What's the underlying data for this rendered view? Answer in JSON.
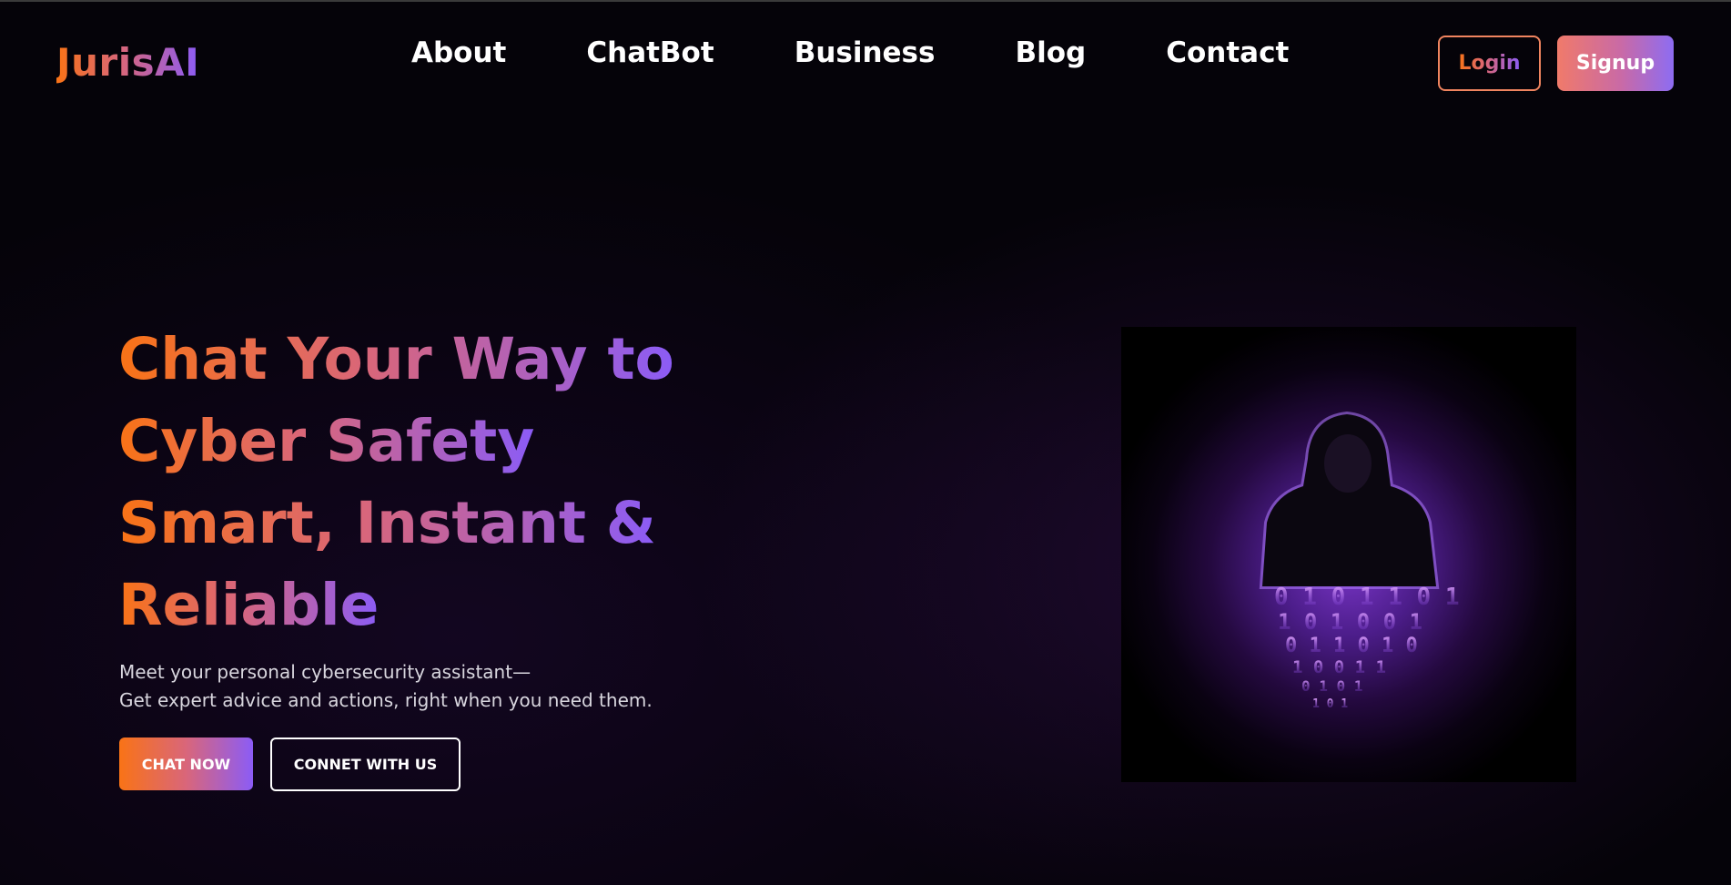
{
  "header": {
    "logo": "JurisAI",
    "nav": [
      "About",
      "ChatBot",
      "Business",
      "Blog",
      "Contact"
    ],
    "login_label": "Login",
    "signup_label": "Signup"
  },
  "hero": {
    "title_lines": [
      "Chat Your Way to",
      "Cyber Safety",
      "Smart, Instant &",
      "Reliable"
    ],
    "description_lines": [
      "Meet your personal cybersecurity assistant—",
      "Get expert advice and actions, right when you need them."
    ],
    "primary_cta": "CHAT NOW",
    "secondary_cta": "CONNET WITH US",
    "image_icon": "hooded-hacker-binary-illustration"
  },
  "colors": {
    "background": "#050309",
    "gradient_start": "#f97316",
    "gradient_mid": "#d9667a",
    "gradient_end": "#8b5cf6",
    "text": "#ffffff"
  }
}
